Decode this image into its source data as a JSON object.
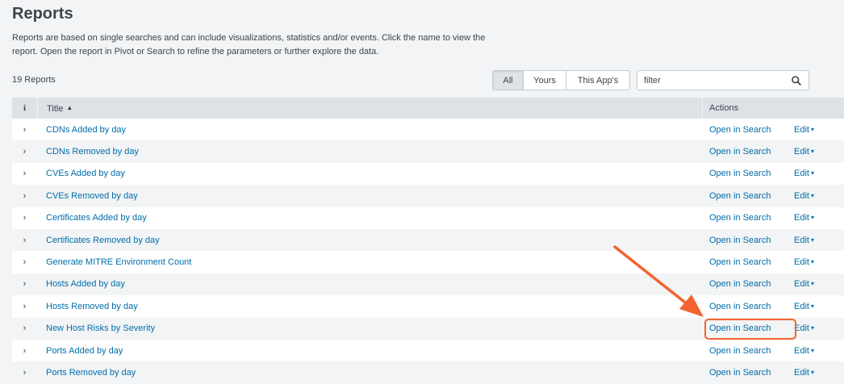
{
  "page": {
    "title": "Reports",
    "description": "Reports are based on single searches and can include visualizations, statistics and/or events. Click the name to view the report. Open the report in Pivot or Search to refine the parameters or further explore the data.",
    "count": "19 Reports"
  },
  "filters": {
    "all": "All",
    "yours": "Yours",
    "app": "This App's",
    "active": "All"
  },
  "search": {
    "value": "filter"
  },
  "table": {
    "info_header": "i",
    "title_header": "Title",
    "sort_indicator": "▲",
    "actions_header": "Actions",
    "expander": "›",
    "open_label": "Open in Search",
    "edit_label": "Edit",
    "edit_caret": "▾",
    "rows": [
      "CDNs Added by day",
      "CDNs Removed by day",
      "CVEs Added by day",
      "CVEs Removed by day",
      "Certificates Added by day",
      "Certificates Removed by day",
      "Generate MITRE Environment Count",
      "Hosts Added by day",
      "Hosts Removed by day",
      "New Host Risks by Severity",
      "Ports Added by day",
      "Ports Removed by day"
    ]
  },
  "annotation": {
    "color": "#f26430",
    "highlighted_row": "New Host Risks by Severity"
  },
  "colors": {
    "link": "#006eaa",
    "background": "#f2f4f5",
    "header": "#dde2e7"
  }
}
